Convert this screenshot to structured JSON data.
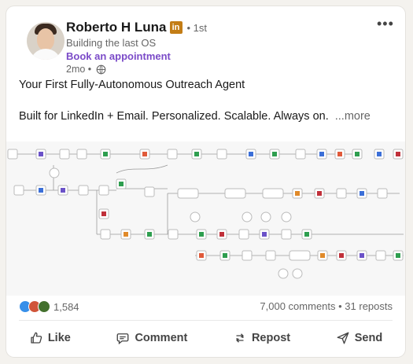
{
  "author": {
    "name": "Roberto H Luna",
    "badge": "in",
    "degree": "• 1st",
    "headline": "Building the last OS",
    "cta": "Book an appointment",
    "time": "2mo •"
  },
  "post": {
    "line1": "Your First Fully-Autonomous Outreach Agent",
    "line2": "Built for LinkedIn + Email. Personalized. Scalable. Always on.",
    "more_label": "...more"
  },
  "social": {
    "reaction_count": "1,584",
    "comments": "7,000 comments",
    "reposts": "31 reposts",
    "separator": " • "
  },
  "actions": {
    "like": "Like",
    "comment": "Comment",
    "repost": "Repost",
    "send": "Send"
  },
  "colors": {
    "brand_badge": "#c37d16",
    "cta": "#7b4bc8"
  }
}
